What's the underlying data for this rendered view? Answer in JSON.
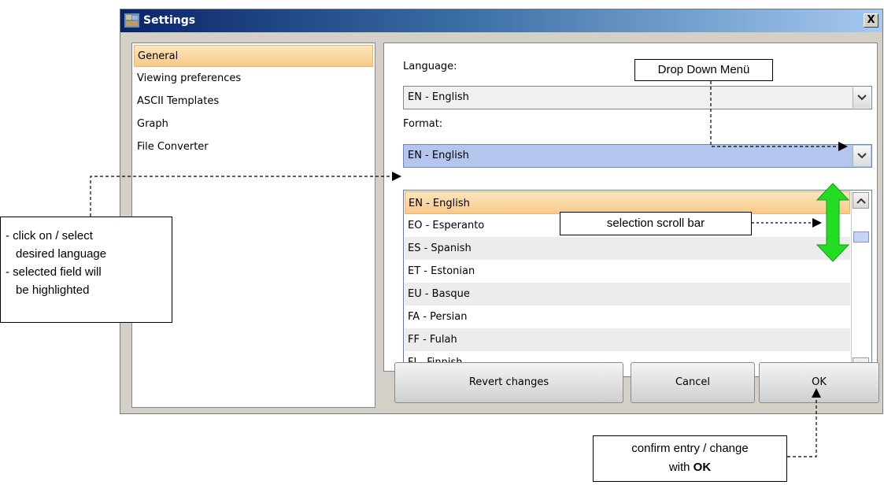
{
  "window": {
    "title": "Settings",
    "close_glyph": "X"
  },
  "sidebar": {
    "items": [
      {
        "label": "General",
        "selected": true
      },
      {
        "label": "Viewing preferences"
      },
      {
        "label": "ASCII Templates"
      },
      {
        "label": "Graph"
      },
      {
        "label": "File Converter"
      }
    ]
  },
  "language": {
    "label": "Language:",
    "value": "EN - English"
  },
  "format": {
    "label": "Format:",
    "value": "EN - English",
    "options": [
      {
        "label": "EN - English",
        "selected": true
      },
      {
        "label": "EO - Esperanto"
      },
      {
        "label": "ES - Spanish"
      },
      {
        "label": "ET - Estonian"
      },
      {
        "label": "EU - Basque"
      },
      {
        "label": "FA - Persian"
      },
      {
        "label": "FF - Fulah"
      },
      {
        "label": "FI - Finnish"
      }
    ]
  },
  "buttons": {
    "revert": "Revert changes",
    "cancel": "Cancel",
    "ok": "OK"
  },
  "annotations": {
    "dropdown": "Drop Down Menü",
    "select_lines": [
      "- click on / select",
      "desired language",
      "- selected field will",
      "be highlighted"
    ],
    "scrollbar": "selection scroll bar",
    "confirm_line1": "confirm entry / change",
    "confirm_with": "with",
    "confirm_ok": "OK"
  },
  "colors": {
    "highlight": "#f7c98a",
    "green_arrow": "#22dd22",
    "title_bar": "#0a246a"
  }
}
